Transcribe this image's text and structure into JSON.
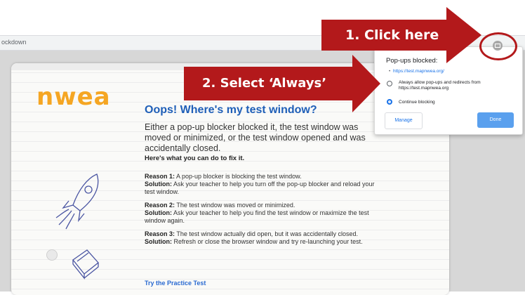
{
  "browser": {
    "tab_text": "ockdown"
  },
  "page": {
    "logo": "nwea",
    "title": "Oops! Where's my test window?",
    "intro": "Either a pop-up blocker blocked it, the test window was moved or minimized, or the test window opened and was accidentally closed.",
    "fix_heading": "Here's what you can do to fix it.",
    "reasons": [
      {
        "reason_label": "Reason 1:",
        "reason_text": " A pop-up blocker is blocking the test window.",
        "solution_label": "Solution:",
        "solution_text": " Ask your teacher to help you turn off the pop-up blocker and reload your test window."
      },
      {
        "reason_label": "Reason 2:",
        "reason_text": " The test window was moved or minimized.",
        "solution_label": "Solution:",
        "solution_text": " Ask your teacher to help you find the test window or maximize the test window again."
      },
      {
        "reason_label": "Reason 3:",
        "reason_text": " The test window actually did open, but it was accidentally closed.",
        "solution_label": "Solution:",
        "solution_text": " Refresh or close the browser window and try re-launching your test."
      }
    ],
    "practice_link": "Try the Practice Test"
  },
  "popup": {
    "title": "Pop-ups blocked:",
    "bullet": "•",
    "blocked_url": "https://test.mapnwea.org/",
    "option_always": "Always allow pop-ups and redirects from https://test.mapnwea.org",
    "option_continue": "Continue blocking",
    "manage_label": "Manage",
    "done_label": "Done"
  },
  "callouts": {
    "step1": "1. Click here",
    "step2": "2. Select ‘Always’"
  },
  "colors": {
    "callout": "#b3191b",
    "logo": "#f5a623",
    "title": "#1f5fb8",
    "link": "#1a73e8"
  },
  "icons": {
    "blocked_popup": "popup-blocked-icon",
    "rocket": "rocket-sketch-icon",
    "book": "book-sketch-icon"
  }
}
